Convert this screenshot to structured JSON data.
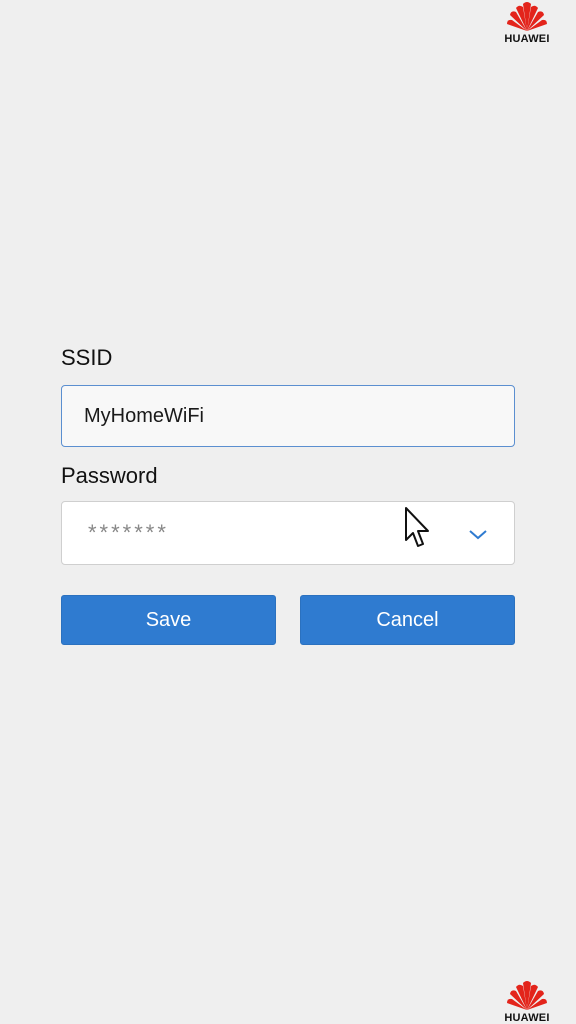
{
  "brand": {
    "name": "HUAWEI",
    "color": "#e3241b"
  },
  "form": {
    "ssid_label": "SSID",
    "ssid_value": "MyHomeWiFi",
    "password_label": "Password",
    "password_value": "*******",
    "save_label": "Save",
    "cancel_label": "Cancel"
  },
  "icons": {
    "dropdown": "chevron-down-icon",
    "pointer": "mouse-pointer-icon"
  },
  "colors": {
    "accent": "#2f7bd0",
    "background": "#efefef"
  }
}
